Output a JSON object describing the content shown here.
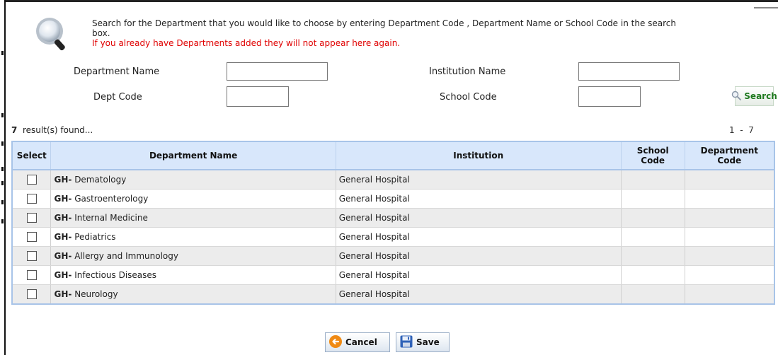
{
  "intro": {
    "line1": "Search for the Department that you would like to choose by entering Department Code , Department Name or School Code in the search box.",
    "warning": "If you already have Departments added they will not appear here again."
  },
  "form": {
    "dept_name_label": "Department Name",
    "dept_name_value": "",
    "dept_code_label": "Dept Code",
    "dept_code_value": "",
    "institution_label": "Institution Name",
    "institution_value": "",
    "school_code_label": "School Code",
    "school_code_value": "",
    "search_label": "Search"
  },
  "results": {
    "count": "7",
    "count_suffix": "result(s) found...",
    "range": "1  -  7"
  },
  "table": {
    "headers": {
      "select": "Select",
      "department": "Department Name",
      "institution": "Institution",
      "school_code": "School Code",
      "department_code": "Department Code"
    },
    "rows": [
      {
        "prefix": "GH-",
        "name": "Dematology",
        "institution": "General Hospital",
        "school_code": "",
        "department_code": ""
      },
      {
        "prefix": "GH-",
        "name": "Gastroenterology",
        "institution": "General Hospital",
        "school_code": "",
        "department_code": ""
      },
      {
        "prefix": "GH-",
        "name": "Internal Medicine",
        "institution": "General Hospital",
        "school_code": "",
        "department_code": ""
      },
      {
        "prefix": "GH-",
        "name": "Pediatrics",
        "institution": "General Hospital",
        "school_code": "",
        "department_code": ""
      },
      {
        "prefix": "GH-",
        "name": "Allergy and Immunology",
        "institution": "General Hospital",
        "school_code": "",
        "department_code": ""
      },
      {
        "prefix": "GH-",
        "name": "Infectious Diseases",
        "institution": "General Hospital",
        "school_code": "",
        "department_code": ""
      },
      {
        "prefix": "GH-",
        "name": "Neurology",
        "institution": "General Hospital",
        "school_code": "",
        "department_code": ""
      }
    ]
  },
  "actions": {
    "cancel_label": "Cancel",
    "save_label": "Save"
  },
  "icons": {
    "intro": "magnifier-icon",
    "search": "search-icon",
    "cancel": "cancel-icon",
    "save": "floppy-disk-icon"
  },
  "colors": {
    "warning": "#e00000",
    "header_bg": "#d8e7fb",
    "search_text": "#1f7a1f"
  }
}
